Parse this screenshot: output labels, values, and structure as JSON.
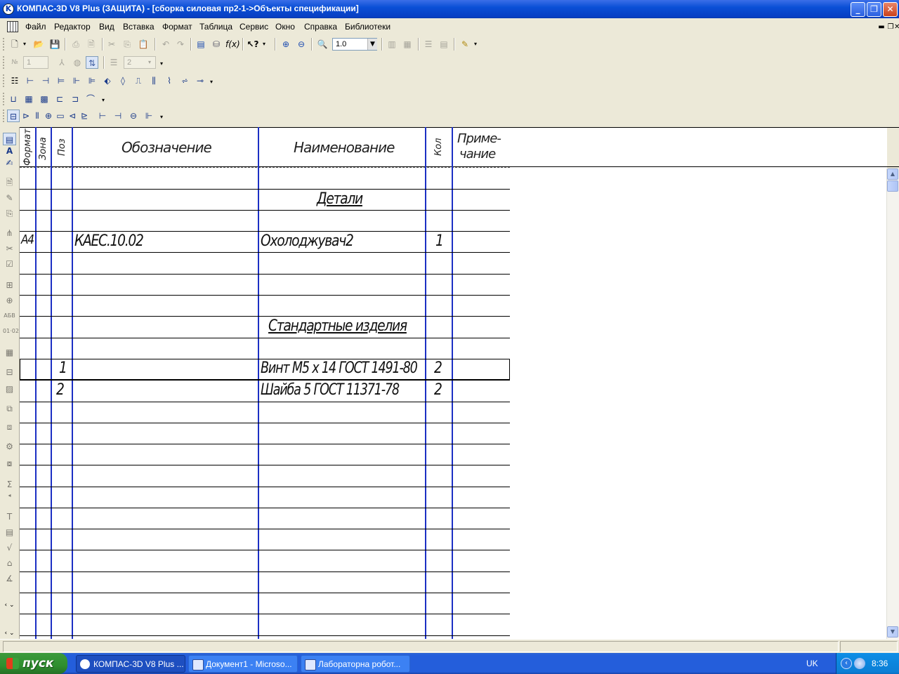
{
  "window": {
    "title": "КОМПАС-3D V8 Plus (ЗАЩИТА) - [сборка силовая пр2-1->Объекты спецификации]",
    "minimize_glyph": "_",
    "maximize_glyph": "❐",
    "close_glyph": "✕"
  },
  "menu": {
    "items": [
      "Файл",
      "Редактор",
      "Вид",
      "Вставка",
      "Формат",
      "Таблица",
      "Сервис",
      "Окно",
      "Справка",
      "Библиотеки"
    ],
    "mdi_minimize": "▬",
    "mdi_restore": "❐",
    "mdi_close": "✕"
  },
  "toolbar": {
    "zoom_value": "1.0",
    "zoom_drop_glyph": "▼",
    "field1_value": "1",
    "field2_value": "2"
  },
  "spec_table": {
    "headers": {
      "format": "Формат",
      "zone": "Зона",
      "pos": "Поз",
      "designation": "Обозначение",
      "name": "Наименование",
      "qty": "Кол",
      "note_line1": "Приме-",
      "note_line2": "чание"
    },
    "sections": {
      "details": "Детали",
      "standard": "Стандартные изделия"
    },
    "rows": [
      {
        "format": "А4",
        "pos": "",
        "designation": "КАЕС.10.02",
        "name": "Охолоджувач2",
        "qty": "1"
      },
      {
        "format": "",
        "pos": "1",
        "designation": "",
        "name": "Винт М5 х 14 ГОСТ 1491-80",
        "qty": "2"
      },
      {
        "format": "",
        "pos": "2",
        "designation": "",
        "name": "Шайба 5 ГОСТ 11371-78",
        "qty": "2"
      }
    ]
  },
  "scrollbar": {
    "up_glyph": "▲",
    "down_glyph": "▼"
  },
  "taskbar": {
    "start_label": "пуск",
    "tasks": [
      "КОМПАС-3D V8 Plus ...",
      "Документ1 - Microso...",
      "Лабораторна робот..."
    ],
    "language": "UK",
    "clock": "8:36"
  },
  "colors": {
    "title_blue": "#0a4fd6",
    "grid_blue": "#1c2fc4",
    "taskbar_blue": "#245edb",
    "start_green": "#2f8f2f"
  }
}
